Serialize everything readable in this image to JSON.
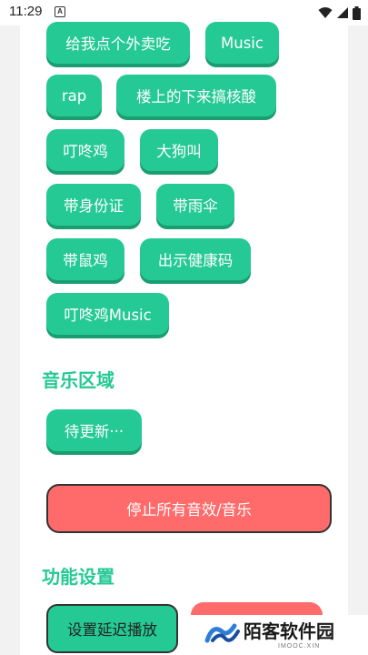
{
  "status_bar": {
    "time": "11:29",
    "app_icon_letter": "A",
    "icons": [
      "wifi-icon",
      "signal-icon",
      "battery-icon"
    ]
  },
  "sound_buttons": [
    {
      "label": "给我点个外卖吃"
    },
    {
      "label": "Music"
    },
    {
      "label": "rap"
    },
    {
      "label": "楼上的下来搞核酸"
    },
    {
      "label": "叮咚鸡"
    },
    {
      "label": "大狗叫"
    },
    {
      "label": "带身份证"
    },
    {
      "label": "带雨伞"
    },
    {
      "label": "带鼠鸡"
    },
    {
      "label": "出示健康码"
    },
    {
      "label": "叮咚鸡Music"
    }
  ],
  "music_section": {
    "title": "音乐区域",
    "pending_label": "待更新···"
  },
  "stop_button": {
    "label": "停止所有音效/音乐"
  },
  "settings_section": {
    "title": "功能设置",
    "delay_button_label": "设置延迟播放"
  },
  "watermark": {
    "text": "陌客软件园",
    "subtext": "IMOOC.XIN"
  },
  "colors": {
    "accent": "#25c993",
    "danger": "#ff6b6b"
  }
}
